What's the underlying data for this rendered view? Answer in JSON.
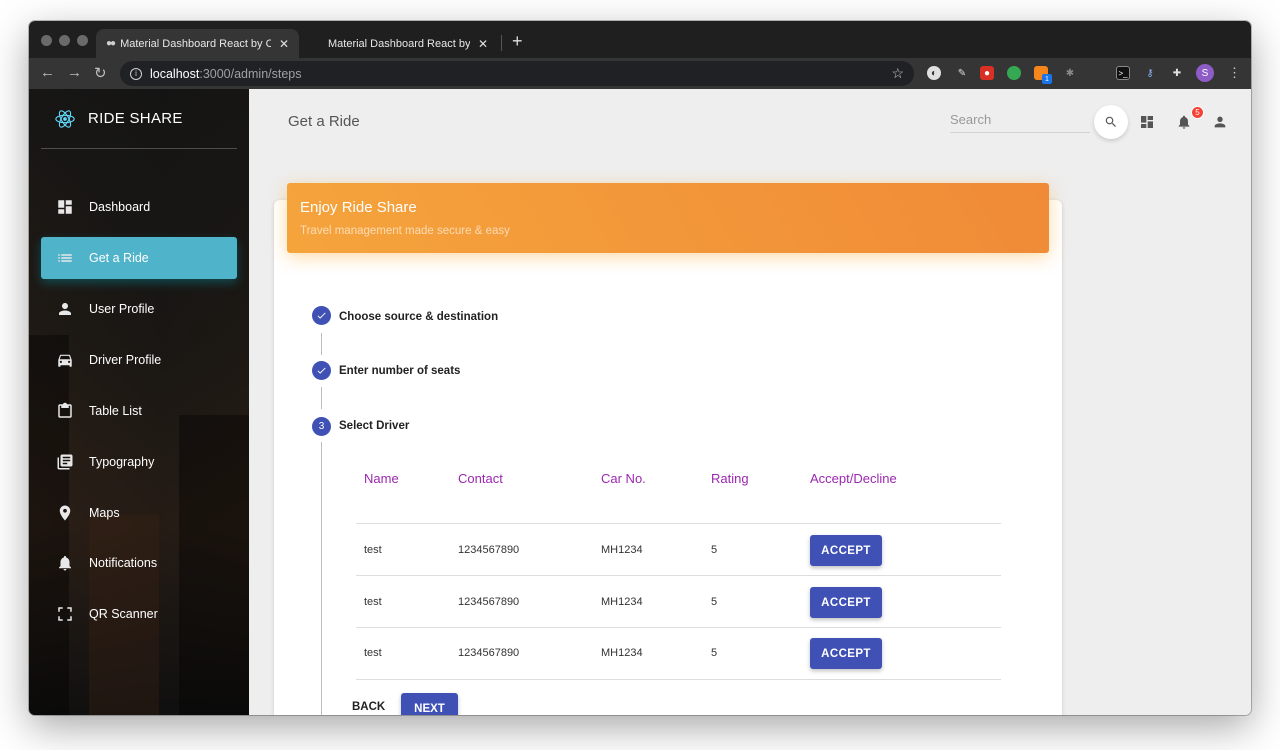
{
  "browser": {
    "tabs": [
      {
        "title": "Material Dashboard React by C",
        "active": true
      },
      {
        "title": "Material Dashboard React by C",
        "active": false
      }
    ],
    "new_tab": "+",
    "close": "✕",
    "url_host": "localhost",
    "url_path": ":3000/admin/steps",
    "profile_initial": "S",
    "extensions": [
      "theme-icon",
      "pen-icon",
      "record-icon",
      "leaf-icon",
      "metamask-icon",
      "bug-icon",
      "terminal-icon",
      "key-icon",
      "puzzle-icon"
    ],
    "extension_badge": "1"
  },
  "sidebar": {
    "brand": "RIDE SHARE",
    "items": [
      {
        "label": "Dashboard",
        "icon": "dashboard-icon",
        "active": false
      },
      {
        "label": "Get a Ride",
        "icon": "list-icon",
        "active": true
      },
      {
        "label": "User Profile",
        "icon": "person-icon",
        "active": false
      },
      {
        "label": "Driver Profile",
        "icon": "car-icon",
        "active": false
      },
      {
        "label": "Table List",
        "icon": "clipboard-icon",
        "active": false
      },
      {
        "label": "Typography",
        "icon": "library-books-icon",
        "active": false
      },
      {
        "label": "Maps",
        "icon": "location-pin-icon",
        "active": false
      },
      {
        "label": "Notifications",
        "icon": "bell-icon",
        "active": false
      },
      {
        "label": "QR Scanner",
        "icon": "scan-frame-icon",
        "active": false
      }
    ],
    "active_color": "#4fb3c9"
  },
  "header": {
    "title": "Get a Ride",
    "search_placeholder": "Search",
    "notification_count": "5"
  },
  "card": {
    "title": "Enjoy Ride Share",
    "subtitle": "Travel management made secure & easy",
    "header_color": "#f39c3a"
  },
  "steps": [
    {
      "label": "Choose source & destination",
      "state": "done",
      "number": ""
    },
    {
      "label": "Enter number of seats",
      "state": "done",
      "number": ""
    },
    {
      "label": "Select Driver",
      "state": "active",
      "number": "3"
    }
  ],
  "table": {
    "columns": [
      "Name",
      "Contact",
      "Car No.",
      "Rating",
      "Accept/Decline"
    ],
    "rows": [
      {
        "name": "test",
        "contact": "1234567890",
        "car": "MH1234",
        "rating": "5",
        "action": "ACCEPT"
      },
      {
        "name": "test",
        "contact": "1234567890",
        "car": "MH1234",
        "rating": "5",
        "action": "ACCEPT"
      },
      {
        "name": "test",
        "contact": "1234567890",
        "car": "MH1234",
        "rating": "5",
        "action": "ACCEPT"
      }
    ]
  },
  "actions": {
    "back": "BACK",
    "next": "NEXT"
  },
  "colors": {
    "primary": "#3f51b5",
    "column_header": "#9c27b0",
    "badge": "#f44336"
  }
}
